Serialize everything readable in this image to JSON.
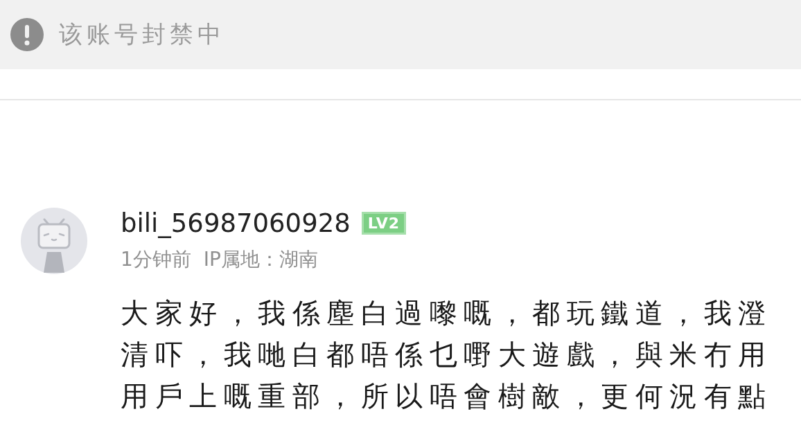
{
  "notice": {
    "text": "该账号封禁中"
  },
  "comment": {
    "username": "bili_56987060928",
    "level_badge": "LV2",
    "time": "1分钟前",
    "ip_location": "IP属地：湖南",
    "body": "大家好，我係塵白過嚟嘅，都玩鐵道，我澄清吓，我哋白都唔係乜嘢大遊戲，與米冇用用戶上嘅重部，所以唔會樹敵，更何況有點"
  }
}
